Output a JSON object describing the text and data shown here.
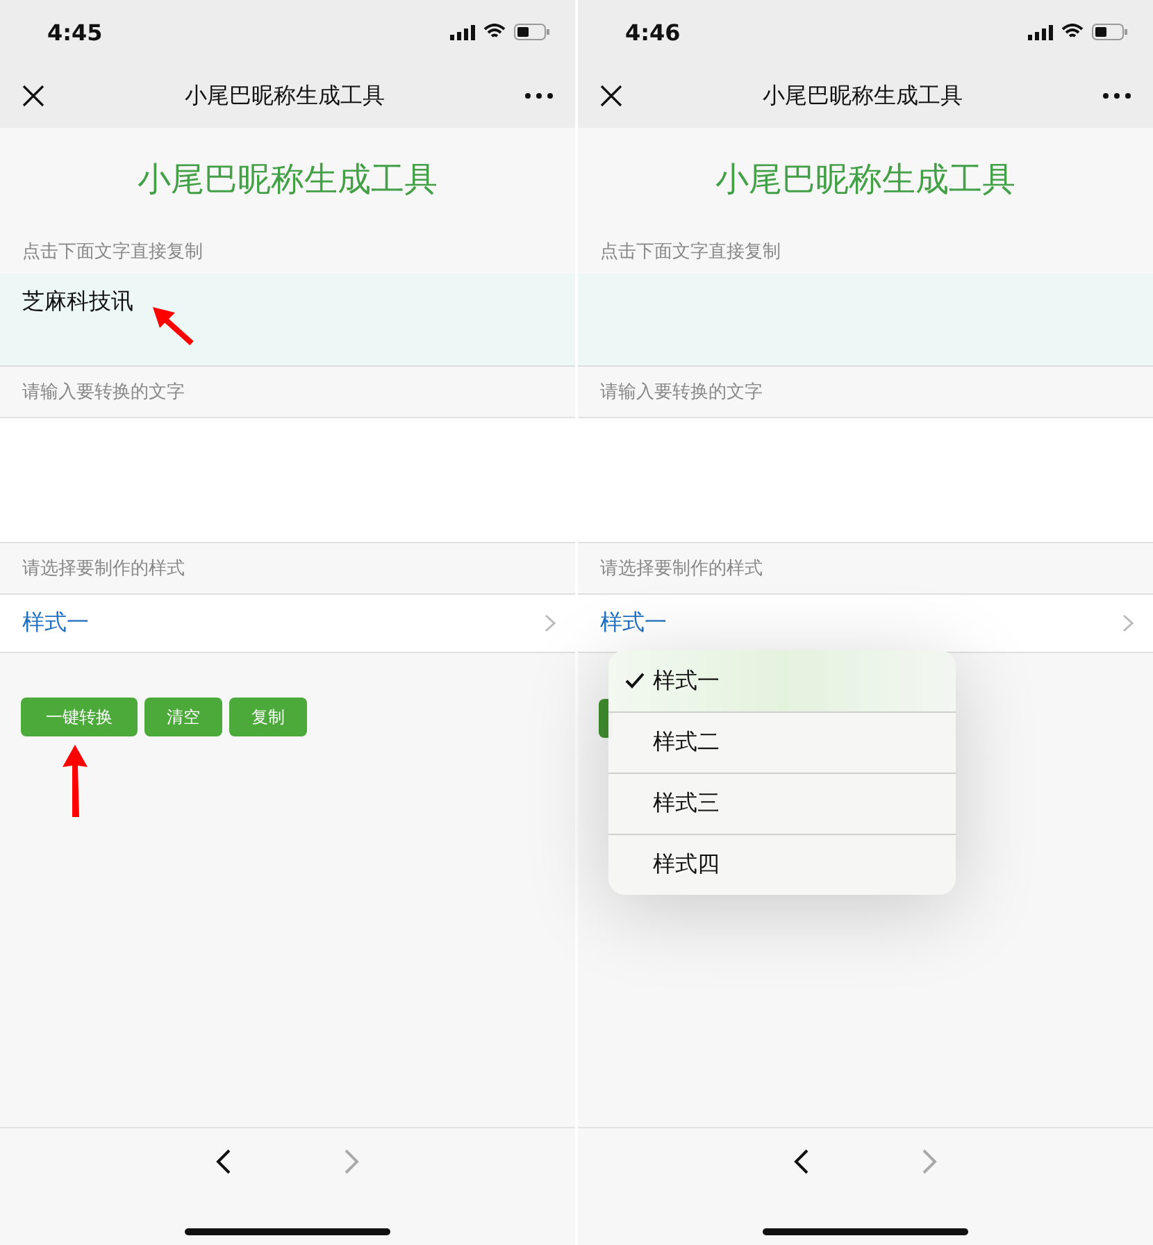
{
  "screens": [
    {
      "time": "4:45",
      "nav_title": "小尾巴昵称生成工具",
      "heading": "小尾巴昵称生成工具",
      "copy_label": "点击下面文字直接复制",
      "result_text": "芝麻科技讯",
      "result_pointer": true,
      "input_label": "请输入要转换的文字",
      "style_label": "请选择要制作的样式",
      "style_value": "样式一",
      "buttons": [
        {
          "label": "一键转换",
          "pointer": true
        },
        {
          "label": "清空",
          "pointer": false
        },
        {
          "label": "复制",
          "pointer": false
        }
      ]
    },
    {
      "time": "4:46",
      "nav_title": "小尾巴昵称生成工具",
      "heading": "小尾巴昵称生成工具",
      "copy_label": "点击下面文字直接复制",
      "result_pointer": false,
      "input_label": "请输入要转换的文字",
      "style_label": "请选择要制作的样式",
      "style_value": "样式一",
      "menu": [
        {
          "label": "样式一",
          "selected": true
        },
        {
          "label": "样式二",
          "selected": false
        },
        {
          "label": "样式三",
          "selected": false
        },
        {
          "label": "样式四",
          "selected": false
        }
      ]
    }
  ]
}
